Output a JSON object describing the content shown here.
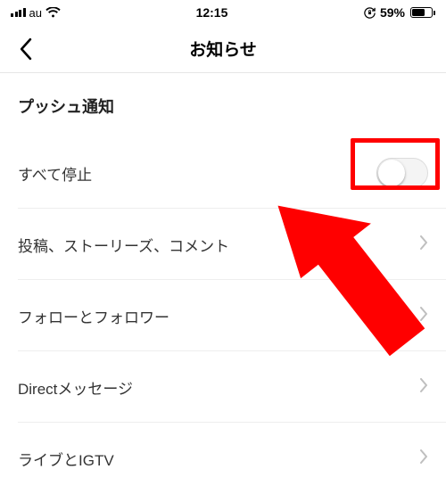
{
  "status_bar": {
    "carrier": "au",
    "time": "12:15",
    "battery_percent": "59%"
  },
  "header": {
    "title": "お知らせ"
  },
  "section": {
    "title": "プッシュ通知"
  },
  "rows": {
    "pause_all": {
      "label": "すべて停止",
      "toggled": false
    },
    "posts": {
      "label": "投稿、ストーリーズ、コメント"
    },
    "follow": {
      "label": "フォローとフォロワー"
    },
    "direct": {
      "label": "Directメッセージ"
    },
    "live": {
      "label": "ライブとIGTV"
    }
  },
  "annotation": {
    "highlight_color": "#ff0000"
  }
}
